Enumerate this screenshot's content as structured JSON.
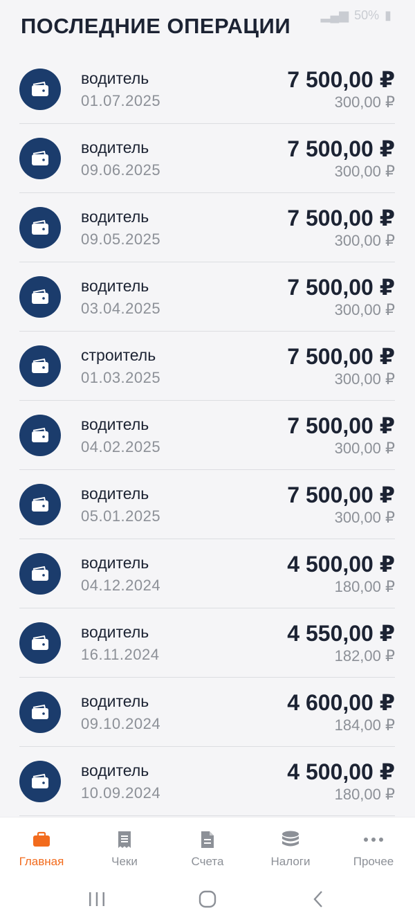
{
  "status_bar": {
    "battery": "50%"
  },
  "title": "ПОСЛЕДНИЕ ОПЕРАЦИИ",
  "operations": [
    {
      "name": "водитель",
      "date": "01.07.2025",
      "amount": "7 500,00 ₽",
      "fee": "300,00 ₽"
    },
    {
      "name": "водитель",
      "date": "09.06.2025",
      "amount": "7 500,00 ₽",
      "fee": "300,00 ₽"
    },
    {
      "name": "водитель",
      "date": "09.05.2025",
      "amount": "7 500,00 ₽",
      "fee": "300,00 ₽"
    },
    {
      "name": "водитель",
      "date": "03.04.2025",
      "amount": "7 500,00 ₽",
      "fee": "300,00 ₽"
    },
    {
      "name": "строитель",
      "date": "01.03.2025",
      "amount": "7 500,00 ₽",
      "fee": "300,00 ₽"
    },
    {
      "name": "водитель",
      "date": "04.02.2025",
      "amount": "7 500,00 ₽",
      "fee": "300,00 ₽"
    },
    {
      "name": "водитель",
      "date": "05.01.2025",
      "amount": "7 500,00 ₽",
      "fee": "300,00 ₽"
    },
    {
      "name": "водитель",
      "date": "04.12.2024",
      "amount": "4 500,00 ₽",
      "fee": "180,00 ₽"
    },
    {
      "name": "водитель",
      "date": "16.11.2024",
      "amount": "4 550,00 ₽",
      "fee": "182,00 ₽"
    },
    {
      "name": "водитель",
      "date": "09.10.2024",
      "amount": "4 600,00 ₽",
      "fee": "184,00 ₽"
    },
    {
      "name": "водитель",
      "date": "10.09.2024",
      "amount": "4 500,00 ₽",
      "fee": "180,00 ₽"
    }
  ],
  "tabs": [
    {
      "label": "Главная",
      "icon": "briefcase-icon",
      "active": true
    },
    {
      "label": "Чеки",
      "icon": "receipt-icon",
      "active": false
    },
    {
      "label": "Счета",
      "icon": "document-icon",
      "active": false
    },
    {
      "label": "Налоги",
      "icon": "coins-icon",
      "active": false
    },
    {
      "label": "Прочее",
      "icon": "more-icon",
      "active": false
    }
  ],
  "colors": {
    "accent": "#f26b1d",
    "icon_circle": "#1b3c6c",
    "text_primary": "#1c2333",
    "text_secondary": "#8c9097",
    "background": "#f5f5f7"
  }
}
